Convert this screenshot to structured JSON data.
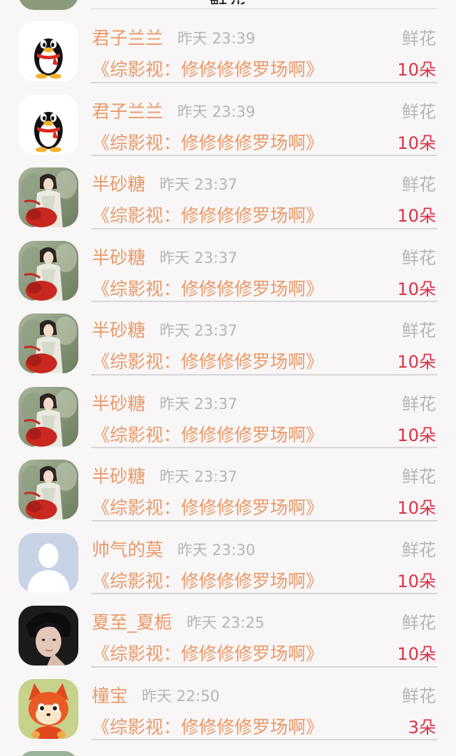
{
  "header": {
    "title": "鲜花"
  },
  "rows": [
    {
      "name": "君子兰兰",
      "time": "昨天 23:39",
      "type": "鲜花",
      "book": "《综影视：修修修修罗场啊》",
      "count": "10朵",
      "avatar": "qq-penguin-icon"
    },
    {
      "name": "君子兰兰",
      "time": "昨天 23:39",
      "type": "鲜花",
      "book": "《综影视：修修修修罗场啊》",
      "count": "10朵",
      "avatar": "qq-penguin-icon"
    },
    {
      "name": "半砂糖",
      "time": "昨天 23:37",
      "type": "鲜花",
      "book": "《综影视：修修修修罗场啊》",
      "count": "10朵",
      "avatar": "ancient-lady-avatar"
    },
    {
      "name": "半砂糖",
      "time": "昨天 23:37",
      "type": "鲜花",
      "book": "《综影视：修修修修罗场啊》",
      "count": "10朵",
      "avatar": "ancient-lady-avatar"
    },
    {
      "name": "半砂糖",
      "time": "昨天 23:37",
      "type": "鲜花",
      "book": "《综影视：修修修修罗场啊》",
      "count": "10朵",
      "avatar": "ancient-lady-avatar"
    },
    {
      "name": "半砂糖",
      "time": "昨天 23:37",
      "type": "鲜花",
      "book": "《综影视：修修修修罗场啊》",
      "count": "10朵",
      "avatar": "ancient-lady-avatar"
    },
    {
      "name": "半砂糖",
      "time": "昨天 23:37",
      "type": "鲜花",
      "book": "《综影视：修修修修罗场啊》",
      "count": "10朵",
      "avatar": "ancient-lady-avatar"
    },
    {
      "name": "帅气的莫",
      "time": "昨天 23:30",
      "type": "鲜花",
      "book": "《综影视：修修修修罗场啊》",
      "count": "10朵",
      "avatar": "default-person-icon"
    },
    {
      "name": "夏至_夏栀",
      "time": "昨天 23:25",
      "type": "鲜花",
      "book": "《综影视：修修修修罗场啊》",
      "count": "10朵",
      "avatar": "young-man-avatar"
    },
    {
      "name": "橦宝",
      "time": "昨天 22:50",
      "type": "鲜花",
      "book": "《综影视：修修修修罗场啊》",
      "count": "3朵",
      "avatar": "red-fox-avatar"
    }
  ],
  "colors": {
    "name": "#e99a68",
    "muted": "#b7b4b5",
    "count": "#d9344a",
    "background": "#f9f6f7"
  }
}
